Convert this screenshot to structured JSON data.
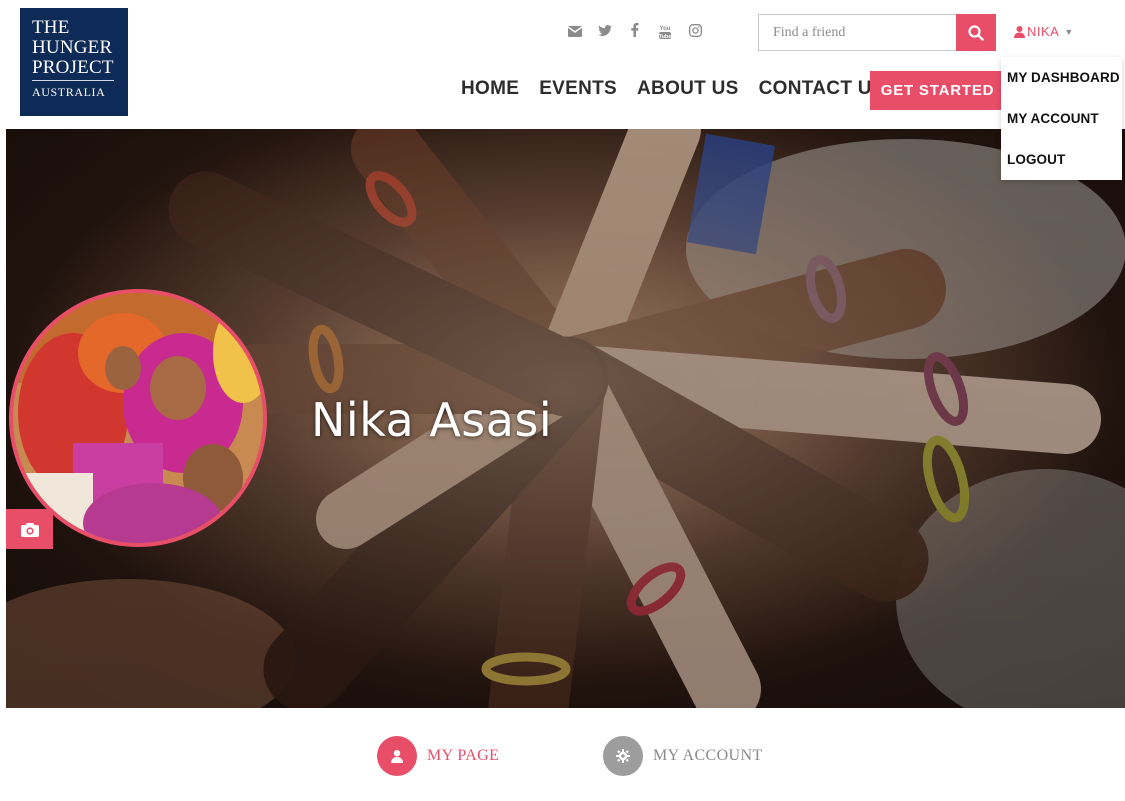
{
  "brand": {
    "logo_line1": "THE",
    "logo_line2": "HUNGER",
    "logo_line3": "PROJECT",
    "logo_line4": "AUSTRALIA",
    "navy": "#0e2a56",
    "accent": "#e94e68"
  },
  "header": {
    "social_icons": [
      "email-icon",
      "twitter-icon",
      "facebook-icon",
      "youtube-icon",
      "instagram-icon"
    ],
    "youtube_text": "You\nTube",
    "search": {
      "placeholder": "Find a friend",
      "value": ""
    },
    "user": {
      "name": "NIKA"
    },
    "nav": [
      "HOME",
      "EVENTS",
      "ABOUT US",
      "CONTACT US"
    ],
    "cta": "GET STARTED"
  },
  "user_dropdown": {
    "items": [
      "MY DASHBOARD",
      "MY ACCOUNT",
      "LOGOUT"
    ]
  },
  "hero": {
    "name": "Nika Asasi"
  },
  "tabs": [
    {
      "label": "MY PAGE",
      "icon": "user-icon",
      "active": true
    },
    {
      "label": "MY ACCOUNT",
      "icon": "gear-icon",
      "active": false
    }
  ]
}
